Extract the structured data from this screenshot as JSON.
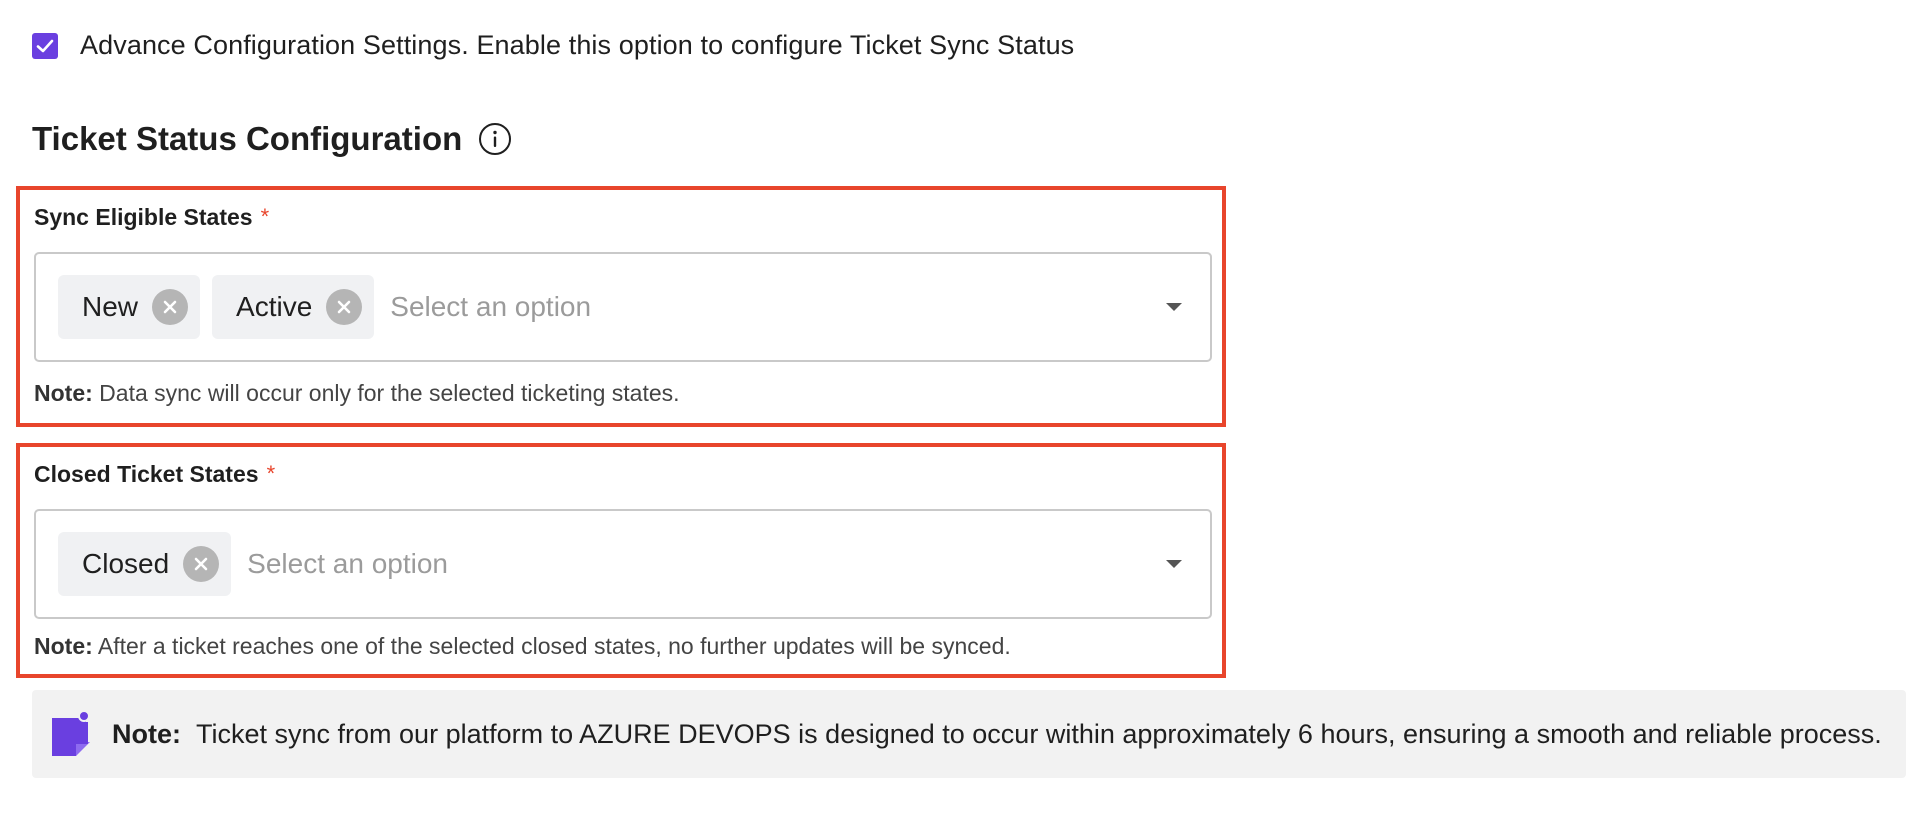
{
  "advanced": {
    "checkbox_checked": true,
    "label": "Advance Configuration Settings. Enable this option to configure Ticket Sync Status"
  },
  "section": {
    "title": "Ticket Status Configuration",
    "info_icon": "info-circle-icon"
  },
  "sync_eligible": {
    "label": "Sync Eligible States",
    "required_mark": "*",
    "chips": [
      "New",
      "Active"
    ],
    "placeholder": "Select an option",
    "note_prefix": "Note:",
    "note_text": "Data sync will occur only for the selected ticketing states."
  },
  "closed_states": {
    "label": "Closed Ticket States",
    "required_mark": "*",
    "chips": [
      "Closed"
    ],
    "placeholder": "Select an option",
    "note_prefix": "Note:",
    "note_text": "After a ticket reaches one of the selected closed states, no further updates will be synced."
  },
  "banner": {
    "icon": "note-sticky-icon",
    "prefix": "Note:",
    "text": "Ticket sync from our platform to AZURE DEVOPS is designed to occur within approximately 6 hours, ensuring a smooth and reliable process."
  },
  "colors": {
    "accent": "#6a3fe0",
    "highlight_border": "#e8452c",
    "required": "#e8452c",
    "chip_bg": "#f0f1f3",
    "banner_bg": "#f2f2f2"
  }
}
